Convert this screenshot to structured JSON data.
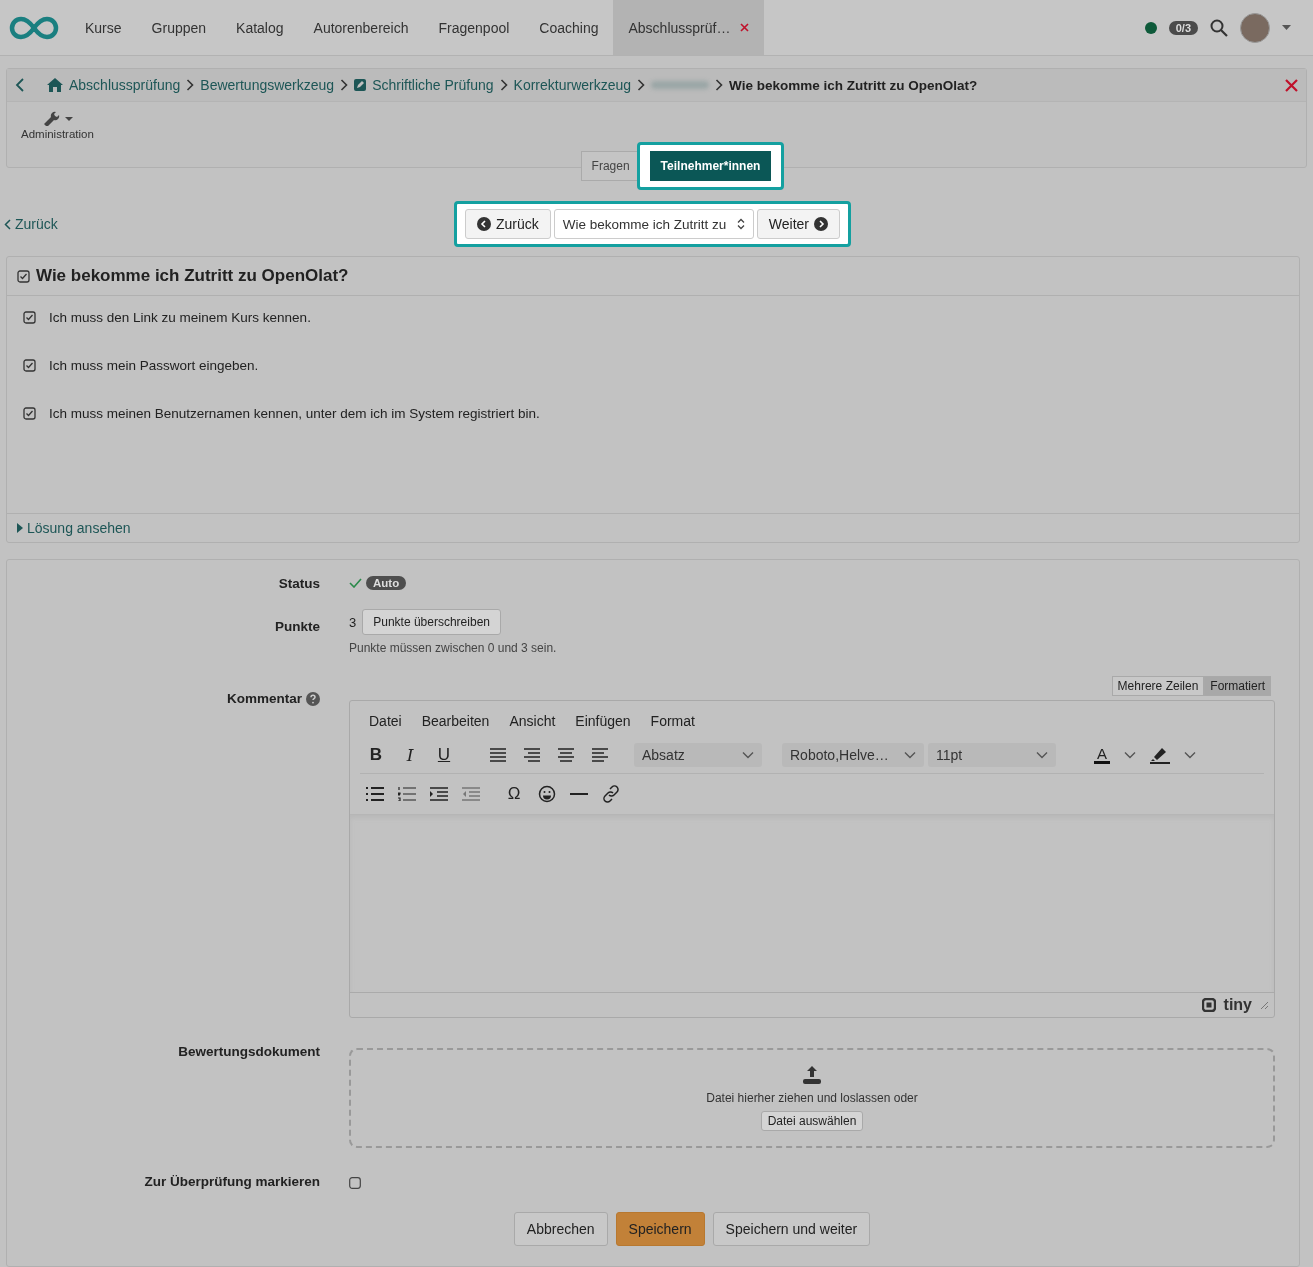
{
  "nav": {
    "items": [
      {
        "label": "Kurse",
        "selected": false
      },
      {
        "label": "Gruppen",
        "selected": false
      },
      {
        "label": "Katalog",
        "selected": false
      },
      {
        "label": "Autorenbereich",
        "selected": false
      },
      {
        "label": "Fragenpool",
        "selected": false
      },
      {
        "label": "Coaching",
        "selected": false
      },
      {
        "label": "Abschlussprüf…",
        "selected": true,
        "closable": true
      }
    ],
    "counter": "0/3"
  },
  "breadcrumb": {
    "items": [
      {
        "label": "Abschlussprüfung",
        "kind": "home"
      },
      {
        "label": "Bewertungswerkzeug",
        "kind": "plain"
      },
      {
        "label": "Schriftliche Prüfung",
        "kind": "edit"
      },
      {
        "label": "Korrekturwerkzeug",
        "kind": "plain"
      },
      {
        "kind": "hidden"
      }
    ],
    "current": "Wie bekomme ich Zutritt zu OpenOlat?"
  },
  "toolbar": {
    "label": "Administration"
  },
  "segments": [
    {
      "label": "Fragen",
      "selected": false
    },
    {
      "label": "Teilnehmer*innen",
      "selected": true
    }
  ],
  "back_link": "Zurück",
  "pager": {
    "previous": "Zurück",
    "select_value": "Wie bekomme ich Zutritt zu",
    "next": "Weiter"
  },
  "question": {
    "title": "Wie bekomme ich Zutritt zu OpenOlat?",
    "options": [
      {
        "text": "Ich muss den Link zu meinem Kurs kennen.",
        "checked": true
      },
      {
        "text": "Ich muss mein Passwort eingeben.",
        "checked": true
      },
      {
        "text": "Ich muss meinen Benutzernamen kennen, unter dem ich im System registriert bin.",
        "checked": true
      }
    ],
    "solution_link": "Lösung ansehen"
  },
  "form": {
    "status": {
      "label": "Status",
      "badge": "Auto"
    },
    "points": {
      "label": "Punkte",
      "value": "3",
      "button": "Punkte überschreiben",
      "hint": "Punkte müssen zwischen 0 und 3 sein."
    },
    "comment": {
      "label": "Kommentar",
      "modes": [
        {
          "label": "Mehrere Zeilen",
          "selected": false
        },
        {
          "label": "Formatiert",
          "selected": true
        }
      ],
      "menus": [
        "Datei",
        "Bearbeiten",
        "Ansicht",
        "Einfügen",
        "Format"
      ],
      "text_buttons": [
        "B",
        "I",
        "U"
      ],
      "block_select": "Absatz",
      "font_select": "Roboto,Helve…",
      "size_select": "11pt",
      "color_button": "A",
      "special_char": "Ω",
      "brand": "tiny"
    },
    "document": {
      "label": "Bewertungsdokument",
      "drop_text": "Datei hierher ziehen und loslassen oder",
      "button": "Datei auswählen"
    },
    "review": {
      "label": "Zur Überprüfung markieren",
      "checked": false
    },
    "buttons": [
      {
        "label": "Abbrechen",
        "kind": "default"
      },
      {
        "label": "Speichern",
        "kind": "primary"
      },
      {
        "label": "Speichern und weiter",
        "kind": "default"
      }
    ]
  }
}
